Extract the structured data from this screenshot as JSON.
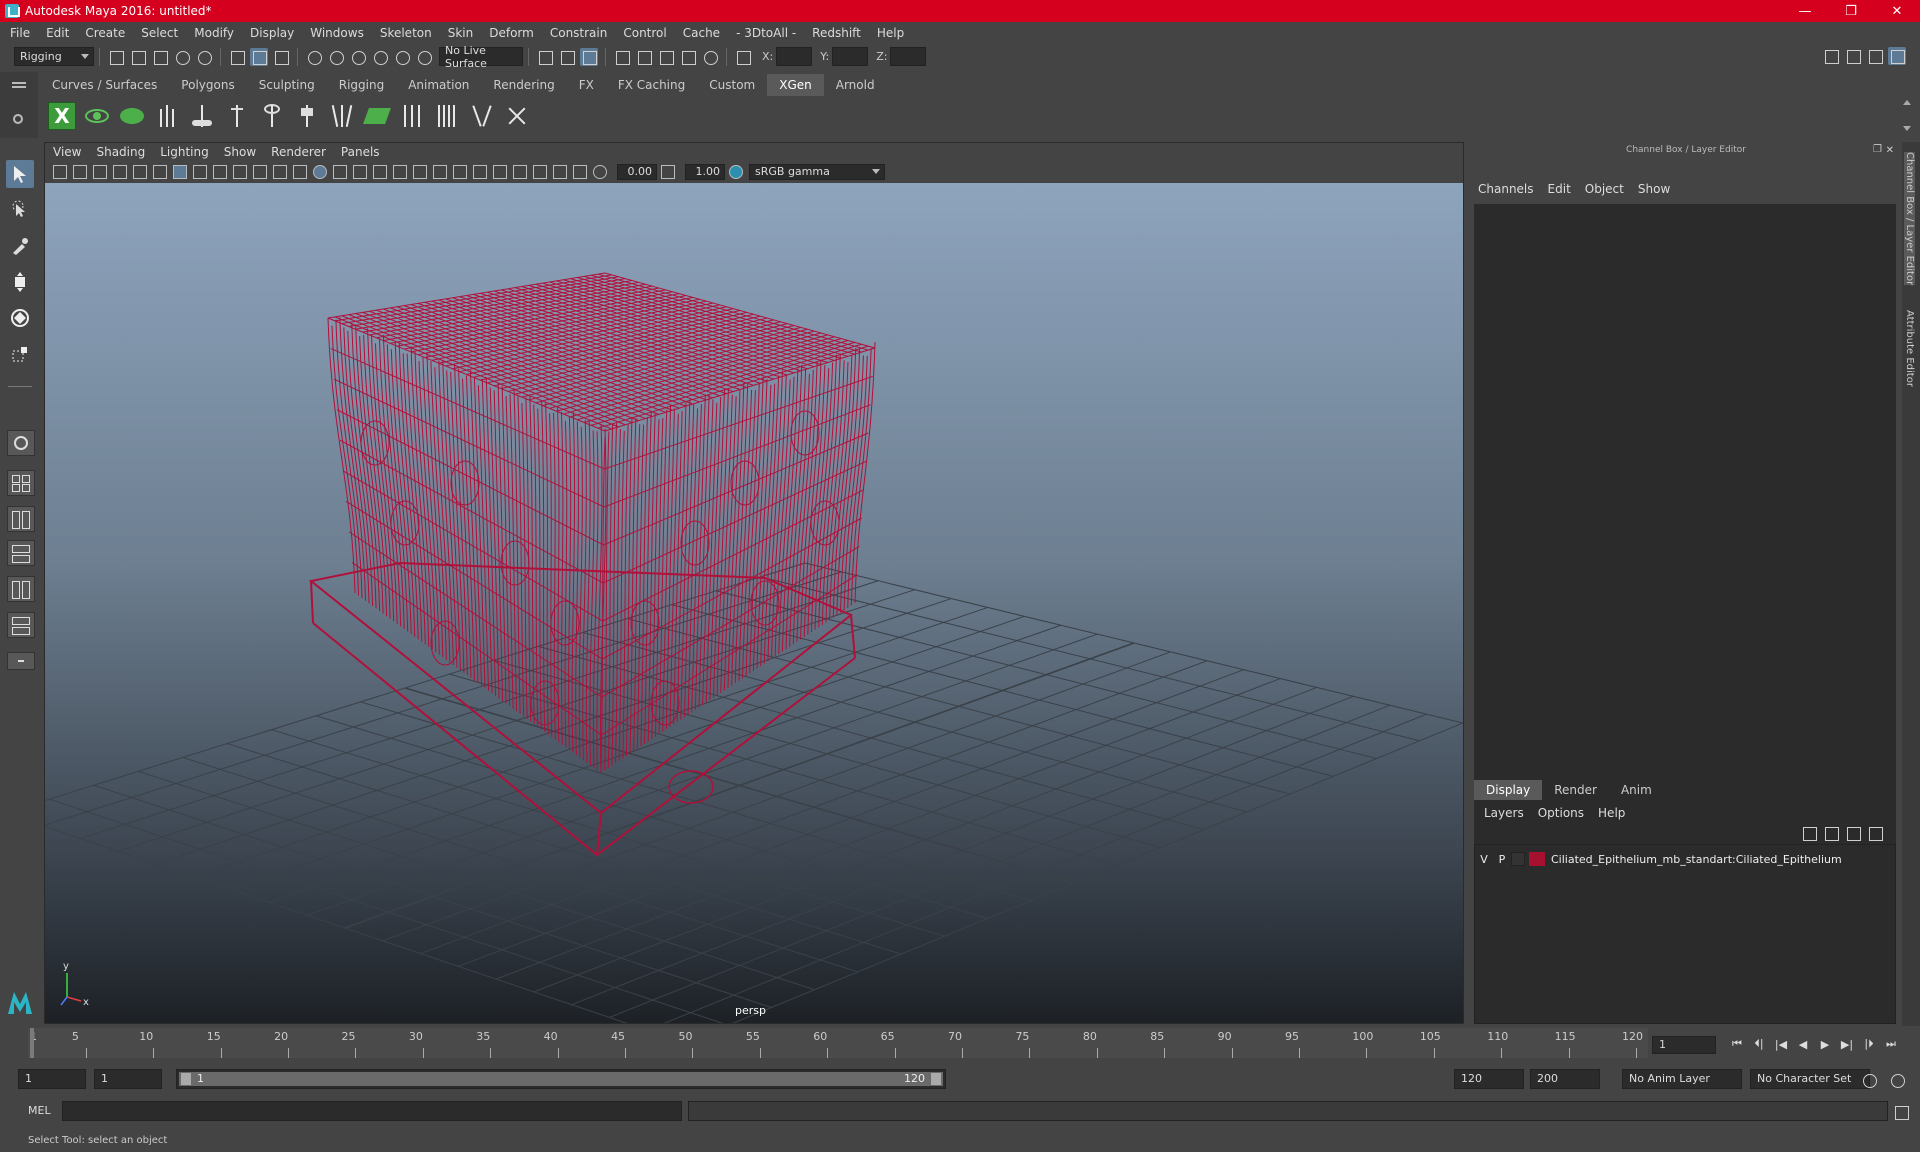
{
  "window": {
    "title": "Autodesk Maya 2016: untitled*",
    "controls": {
      "minimize": "—",
      "maximize": "❐",
      "close": "✕"
    }
  },
  "menus": [
    "File",
    "Edit",
    "Create",
    "Select",
    "Modify",
    "Display",
    "Windows",
    "Skeleton",
    "Skin",
    "Deform",
    "Constrain",
    "Control",
    "Cache",
    "- 3DtoAll -",
    "Redshift",
    "Help"
  ],
  "status_line": {
    "menu_set": "Rigging",
    "live_surface": "No Live Surface",
    "coord_labels": {
      "x": "X:",
      "y": "Y:",
      "z": "Z:"
    }
  },
  "shelf": {
    "tabs": [
      "Curves / Surfaces",
      "Polygons",
      "Sculpting",
      "Rigging",
      "Animation",
      "Rendering",
      "FX",
      "FX Caching",
      "Custom",
      "XGen",
      "Arnold"
    ],
    "active_tab": "XGen",
    "xgen_label": "X"
  },
  "viewport": {
    "menu": [
      "View",
      "Shading",
      "Lighting",
      "Show",
      "Renderer",
      "Panels"
    ],
    "exposure": "0.00",
    "gamma_value": "1.00",
    "color_space": "sRGB gamma",
    "camera": "persp",
    "axis_labels": {
      "x": "x",
      "y": "y"
    },
    "wire_color": "#b0103a",
    "grid_color": "#3a4149"
  },
  "channel_box": {
    "header": "Channel Box / Layer Editor",
    "menu": [
      "Channels",
      "Edit",
      "Object",
      "Show"
    ],
    "layer_tabs": [
      "Display",
      "Render",
      "Anim"
    ],
    "layer_menu": [
      "Layers",
      "Options",
      "Help"
    ],
    "layer": {
      "visible": "V",
      "playback": "P",
      "name": "Ciliated_Epithelium_mb_standart:Ciliated_Epithelium",
      "color": "#a5112f"
    }
  },
  "side_tabs": [
    "Channel Box / Layer Editor",
    "Attribute Editor"
  ],
  "timeline": {
    "labels": [
      "1",
      "5",
      "10",
      "15",
      "20",
      "25",
      "30",
      "35",
      "40",
      "45",
      "50",
      "55",
      "60",
      "65",
      "70",
      "75",
      "80",
      "85",
      "90",
      "95",
      "100",
      "105",
      "110",
      "115",
      "120"
    ],
    "current_frame": "1"
  },
  "range": {
    "start": "1",
    "playback_start": "1",
    "slider_low": "1",
    "slider_high": "120",
    "playback_end": "120",
    "end": "200",
    "anim_layer": "No Anim Layer",
    "character_set": "No Character Set"
  },
  "command_line": {
    "lang": "MEL"
  },
  "help_line": "Select Tool: select an object",
  "accent_color": "#5d7a96"
}
